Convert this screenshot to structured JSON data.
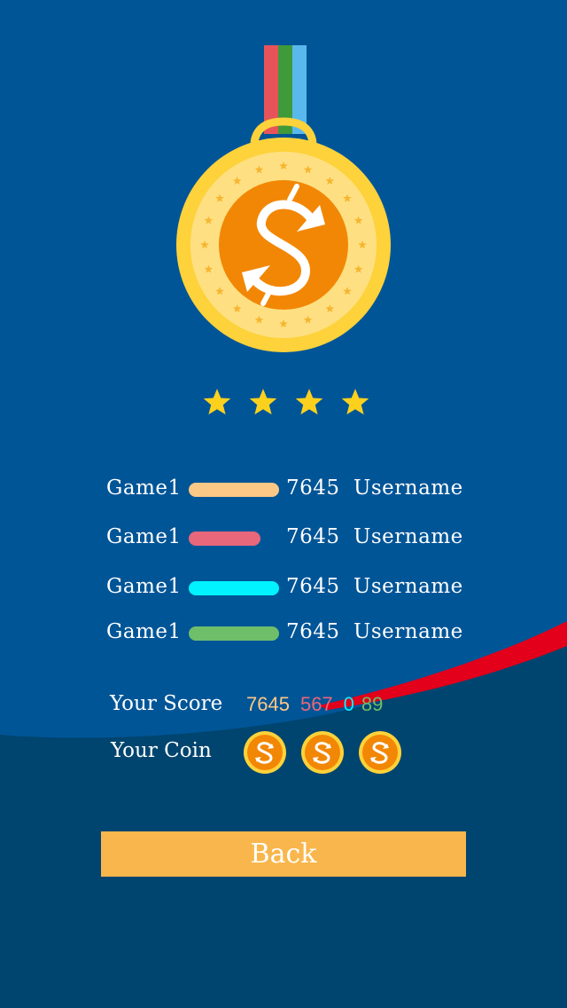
{
  "leaderboard": [
    {
      "game": "Game1",
      "score": "7645",
      "user": "Username",
      "bar_color": "#fcc886",
      "bar_fill": 1.0
    },
    {
      "game": "Game1",
      "score": "7645",
      "user": "Username",
      "bar_color": "#e8677b",
      "bar_fill": 0.79
    },
    {
      "game": "Game1",
      "score": "7645",
      "user": "Username",
      "bar_color": "#00f3ff",
      "bar_fill": 1.0
    },
    {
      "game": "Game1",
      "score": "7645",
      "user": "Username",
      "bar_color": "#6fbe6a",
      "bar_fill": 1.0
    }
  ],
  "rating": {
    "stars": 4
  },
  "your_score": {
    "label": "Your Score",
    "values": [
      {
        "text": "7645",
        "color": "#fcc886"
      },
      {
        "text": "567",
        "color": "#e8677b"
      },
      {
        "text": "0",
        "color": "#00f3ff"
      },
      {
        "text": "89",
        "color": "#6fbe6a"
      }
    ]
  },
  "your_coin": {
    "label": "Your Coin",
    "count": 3,
    "icon": "coin-icon"
  },
  "back_button": {
    "label": "Back"
  },
  "colors": {
    "background": "#005597",
    "bottom_band": "#00456f",
    "accent_red": "#e2001a",
    "button": "#f8b64c",
    "medal_gold": "#fdd23a",
    "medal_orange": "#f28705"
  }
}
